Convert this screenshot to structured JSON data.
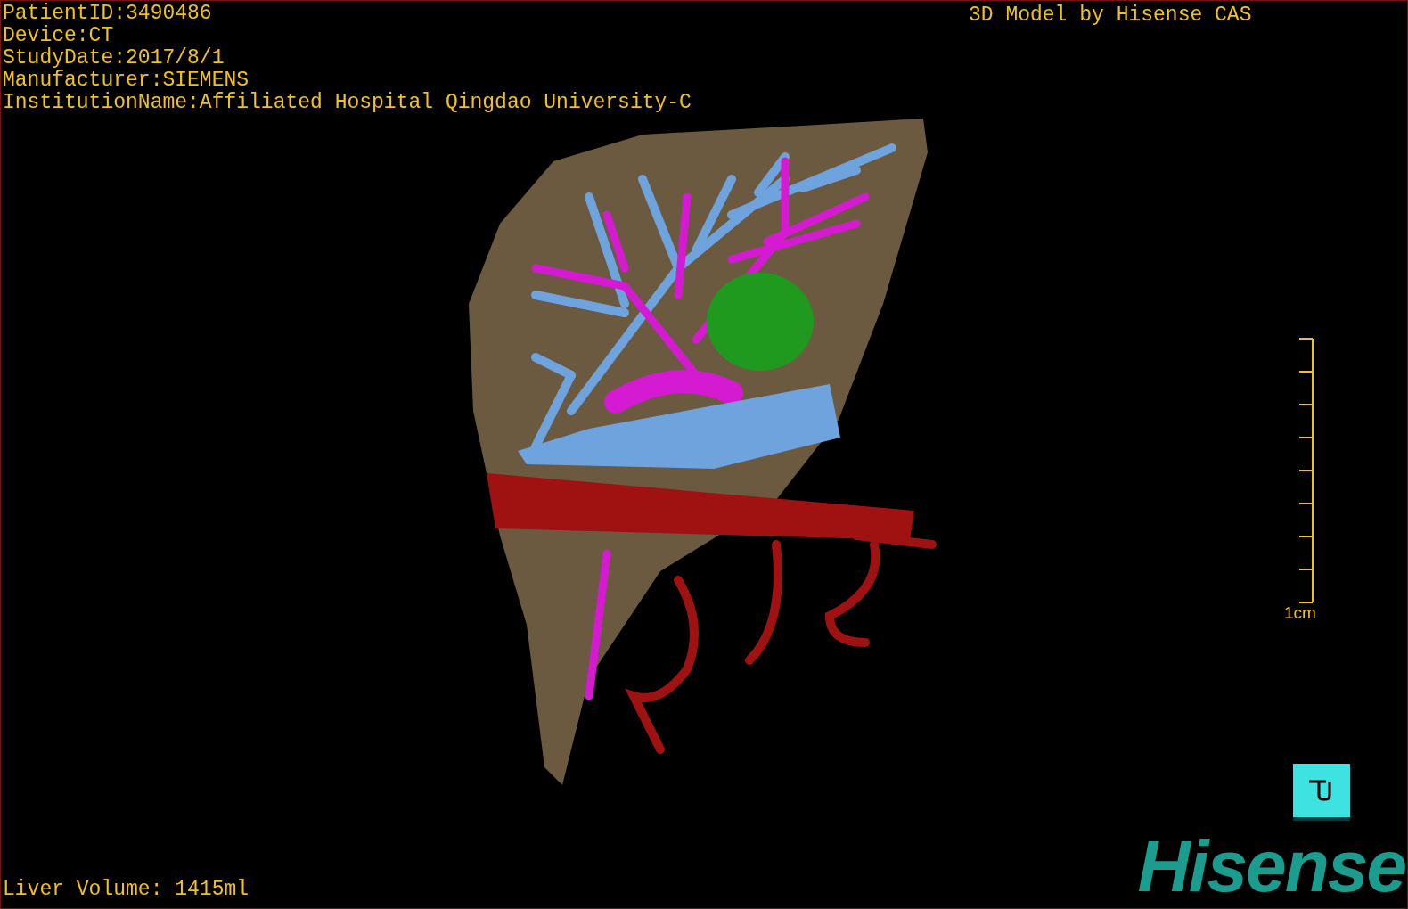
{
  "patient_info": [
    "PatientID:3490486",
    "Device:CT",
    "StudyDate:2017/8/1",
    "Manufacturer:SIEMENS",
    "InstitutionName:Affiliated Hospital Qingdao University-C"
  ],
  "model_credit": "3D Model by Hisense CAS",
  "scale_bar": {
    "label": "1cm"
  },
  "liver_volume": "Liver Volume: 1415ml",
  "brand": "Hisense"
}
